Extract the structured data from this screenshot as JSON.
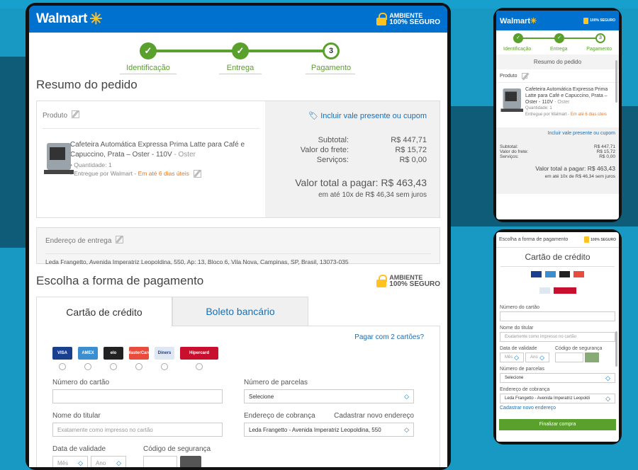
{
  "brand": {
    "name": "Walmart",
    "secure_small": "AMBIENTE",
    "secure_big": "100% SEGURO"
  },
  "steps": [
    {
      "label": "Identificação",
      "mark": "✓"
    },
    {
      "label": "Entrega",
      "mark": "✓"
    },
    {
      "label": "Pagamento",
      "mark": "3"
    }
  ],
  "summary": {
    "title": "Resumo do pedido",
    "product_label": "Produto",
    "product_name": "Cafeteira Automática Expressa Prima Latte para Café e Capuccino, Prata – Oster - 110V",
    "product_brand": "- Oster",
    "quantity": "Quantidade: 1",
    "delivered_by": "Entregue por Walmart",
    "delivery_time": "Em até 6 dias úteis",
    "coupon_link": "Incluir vale presente ou cupom",
    "subtotal_label": "Subtotal:",
    "subtotal": "R$ 447,71",
    "shipping_label": "Valor do frete:",
    "shipping": "R$ 15,72",
    "services_label": "Serviços:",
    "services": "R$ 0,00",
    "total": "Valor total a pagar: R$ 463,43",
    "installments": "em até 10x de R$ 46,34 sem juros"
  },
  "address": {
    "label": "Endereço de entrega",
    "value": "Leda Frangetto, Avenida Imperatriz Leopoldina, 550, Ap: 13, Bloco 6, Vila Nova, Campinas, SP, Brasil, 13073-035"
  },
  "payment": {
    "title": "Escolha a forma de pagamento",
    "tab_card": "Cartão de crédito",
    "tab_boleto": "Boleto bancário",
    "two_cards": "Pagar com 2 cartões?",
    "cards": [
      {
        "name": "VISA",
        "color": "#1a3f8f"
      },
      {
        "name": "AMEX",
        "color": "#3b8fd1"
      },
      {
        "name": "elo",
        "color": "#222222"
      },
      {
        "name": "MasterCard",
        "color": "#e94b3c"
      },
      {
        "name": "Diners",
        "color": "#dfe7f2"
      },
      {
        "name": "Hipercard",
        "color": "#c8102e"
      }
    ],
    "card_number_label": "Número do cartão",
    "installments_label": "Número de parcelas",
    "installments_value": "Selecione",
    "holder_label": "Nome do titular",
    "holder_placeholder": "Exatamente como impresso no cartão",
    "billing_label": "Endereço de cobrança",
    "new_address": "Cadastrar novo endereço",
    "billing_value": "Leda Frangetto - Avenida Imperatriz Leopoldina, 550",
    "expiry_label": "Data de validade",
    "month": "Mês",
    "year": "Ano",
    "cvv_label": "Código de segurança"
  },
  "mobile": {
    "summary_title": "Resumo do pedido",
    "product_name": "Cafeteira Automática Expressa Prima Latte para Café e Capuccino, Prata – Oster - 110V",
    "brand_tail": "- Oster",
    "quantity": "Quantidade: 1",
    "delivered_by": "Entregue por Walmart",
    "delivery_time": "Em até 6 dias úteis",
    "total": "Valor total a pagar: R$ 463,43",
    "installments": "em até 10x de R$ 46,34 sem juros",
    "pay_title": "Escolha a forma de pagamento",
    "card_tab": "Cartão de crédito",
    "new_address": "Cadastrar novo endereço",
    "billing_value": "Leda Frangetto - Avenida Imperatriz Leopoldi",
    "finish": "Finalizar compra"
  },
  "colors": {
    "header": "#0071ce",
    "accent": "#5aa02c",
    "link": "#1a6fb5",
    "warn": "#e87722"
  }
}
